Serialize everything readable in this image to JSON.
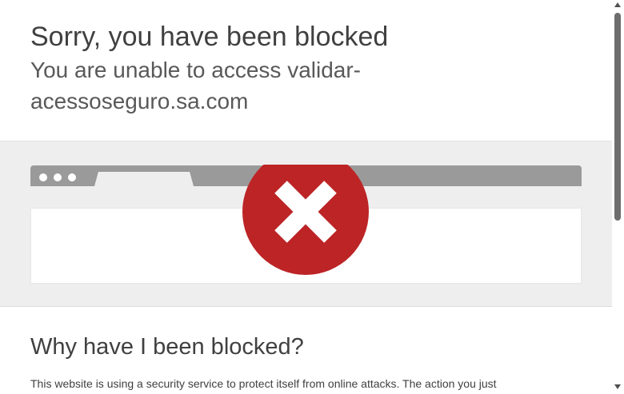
{
  "header": {
    "title": "Sorry, you have been blocked",
    "subtitle": "You are unable to access validar-acessoseguro.sa.com"
  },
  "illustration": {
    "icon": "error-x-circle-icon",
    "icon_color": "#bd2426",
    "bar_color": "#9a9a9a"
  },
  "why": {
    "heading": "Why have I been blocked?",
    "text": "This website is using a security service to protect itself from online attacks. The action you just"
  },
  "colors": {
    "background": "#ffffff",
    "band": "#eeeeee",
    "text": "#404040"
  }
}
